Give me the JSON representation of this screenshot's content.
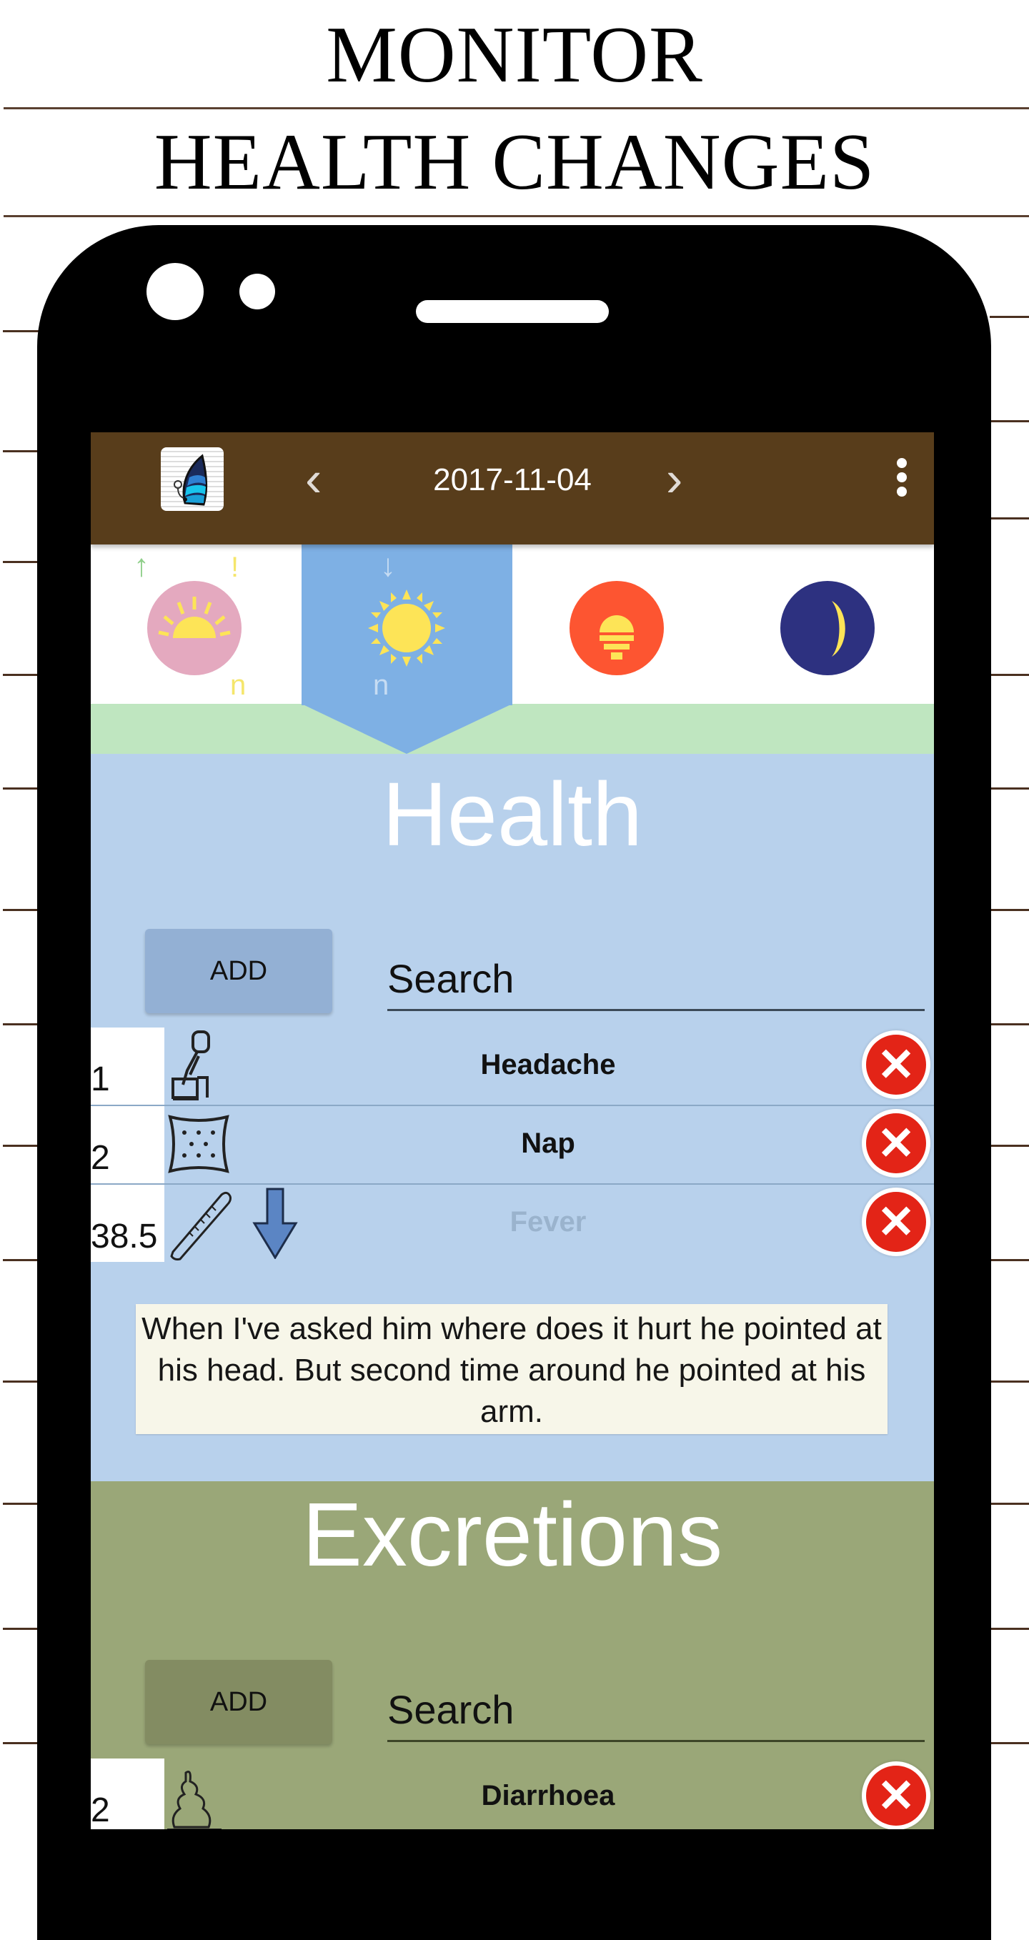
{
  "banner": {
    "line1": "MONITOR",
    "line2": "HEALTH CHANGES"
  },
  "colors": {
    "appbar": "#583d1b",
    "health_bg": "#b8d1ec",
    "excretions_bg": "#9aa778",
    "active_tab": "#7eb0e4",
    "delete": "#e32417"
  },
  "appbar": {
    "logo": "butterfly-logo-icon",
    "prev_label": "‹",
    "date": "2017-11-04",
    "next_label": "›",
    "menu": "more-vert-icon"
  },
  "day_tabs": [
    {
      "name": "morning",
      "icon": "sunrise-icon",
      "marker_top_left": "↑",
      "marker_top_right": "!",
      "marker_bottom": "n",
      "active": false
    },
    {
      "name": "noon",
      "icon": "sun-icon",
      "marker_top": "↓",
      "marker_bottom": "n",
      "active": true
    },
    {
      "name": "evening",
      "icon": "sunset-icon",
      "active": false
    },
    {
      "name": "night",
      "icon": "moon-icon",
      "active": false
    }
  ],
  "health": {
    "title": "Health",
    "add_label": "ADD",
    "search_placeholder": "Search",
    "items": [
      {
        "qty": "1",
        "icon": "headache-icon",
        "label": "Headache",
        "faded": false
      },
      {
        "qty": "2",
        "icon": "pillow-icon",
        "label": "Nap",
        "faded": false
      },
      {
        "qty": "38.5",
        "icon": "thermometer-icon",
        "trend": "arrow-down-icon",
        "label": "Fever",
        "faded": true
      }
    ],
    "note": "When I've asked him where does it hurt he pointed at his head. But second time around he pointed at his arm."
  },
  "excretions": {
    "title": "Excretions",
    "add_label": "ADD",
    "search_placeholder": "Search",
    "items": [
      {
        "qty": "2",
        "icon": "stool-icon",
        "label": "Diarrhoea"
      }
    ]
  },
  "delete_glyph": "✕"
}
